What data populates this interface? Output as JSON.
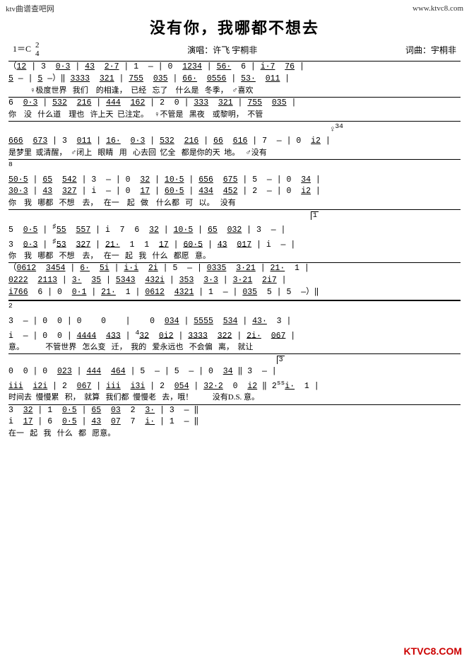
{
  "header": {
    "site_left": "ktv曲谱查吧网",
    "site_right": "www.ktvc8.com"
  },
  "title": "没有你，我哪都不想去",
  "meta": {
    "key": "1＝C",
    "time_num": "2",
    "time_den": "4",
    "performer_label": "演唱：许飞 宇桐非",
    "composer_label": "词曲：宇桐非"
  },
  "score_lines": [
    {
      "type": "notation",
      "content": "（12 | 3  0·3 | 43  2·7 | 1  —  | 0  1234 | 56·  6  | i·7  76 |"
    },
    {
      "type": "notation",
      "content": " 5 — | 5 —）║ 3333  321 | 755  035 | 66·  0556 | 53·  011 |"
    },
    {
      "type": "lyric",
      "content": "          ♀极度世界    我们    的相逢，  已经    忘了    什么是    冬季，  ♂喜欢"
    },
    {
      "type": "notation",
      "content": " 6  0·3 | 532  216 | 444  162 | 2  0  | 333  321 | 755  035 |"
    },
    {
      "type": "lyric",
      "content": " 你    没    什么道    理也    许上天  已注定。    ♀不管是    黑夜    或黎明，  不管"
    },
    {
      "type": "notation",
      "content": " 666  673 | 3  011 | 16·  0·3 | 532  216 | 66  616 | 7  —  | 0  i2 |"
    },
    {
      "type": "lyric",
      "content": " 是梦里  或清醒，    ♂闭上    眼睛    用    心去回  忆全    都是你的天  地。    ♂没有"
    },
    {
      "type": "notation",
      "content": " 50·5 | 65  542 | 3  — | 0  32 | 10·5 | 656  675 | 5  — | 0  34 |"
    },
    {
      "type": "notation",
      "content": " 30·3 | 43  327 | i  — | 0  17 | 60·5 | 434  452 | 2  — | 0  i2 |"
    },
    {
      "type": "lyric",
      "content": " 你    我    哪都    不想    去，    在一    起    做    什么都    可    以。    没有"
    },
    {
      "type": "notation",
      "content": " 5  0·5 | ♯55  557 | i  7  6  32 | 10·5 | 65  032 | 3  — |"
    },
    {
      "type": "notation",
      "content": " 3  0·3 | ♯53  327 | 21·  1  1  17 | 60·5 | 43  017 | i  — |"
    },
    {
      "type": "lyric",
      "content": " 你    我    哪都    不想    去，    在一    起    我    什么    都愿    意。"
    },
    {
      "type": "notation",
      "content": "（0612  3454 | 6·  5i | i·i  2i | 5  — | 0335  3·21 | 21·  1  |"
    },
    {
      "type": "notation",
      "content": " 0222  2113 | 3·  35 | 5343  432i | 353  3·3 | 3·21  2i7 |"
    },
    {
      "type": "notation",
      "content": " i766  6 | 0  0·1 | 21·  1  | 0612  4321 | 1  — | 035  5 | 5  —）║"
    },
    {
      "type": "notation",
      "content": " 3  — | 0  0  | 0    0    |     0  034 | 5555  534 | 43·  3  |"
    },
    {
      "type": "notation",
      "content": " i  — | 0  0 | 4444  433 | ⁴32  0i2 | 3333  322 | 2i·  067 |"
    },
    {
      "type": "lyric",
      "content": " 意。            不管世界    怎么变    迁，  我的    爱永远也    不会偏    离，  就让"
    },
    {
      "type": "notation",
      "content": " 0  0  | 0  023 | 444  464 | 5  — | 5  — | 0  34 ║ 3  — |"
    },
    {
      "type": "notation",
      "content": " iii  i2i | 2  067 | iii  i3i | 2  054 | 32·2  0  i2 ║ 2ˢˢi·  1  |"
    },
    {
      "type": "lyric",
      "content": " 时间去  慢慢累    积，  就算    我们都  慢慢老    去，哦！              没有D.S. 意。"
    },
    {
      "type": "notation",
      "content": " 3  32 | 1  0·5 | 65  03  2  3· | 3  — ‖"
    },
    {
      "type": "notation",
      "content": " i  17 | 6  0·5 | 43  07  7  i· | 1  — ‖"
    },
    {
      "type": "lyric",
      "content": " 在一    起    我    什么    都    愿意。"
    }
  ],
  "bottom_logo": "KTVC8.COM"
}
